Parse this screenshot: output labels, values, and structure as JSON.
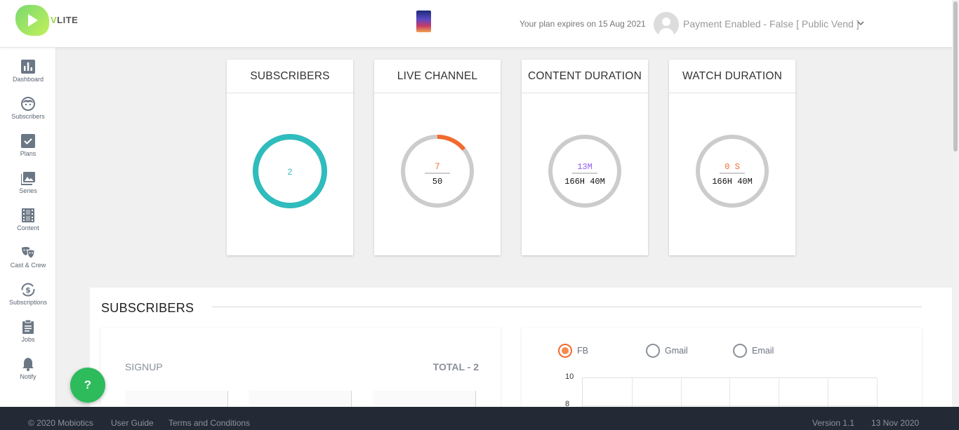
{
  "header": {
    "brand": {
      "v": "V",
      "rest": "LITE"
    },
    "plan_text": "Your plan expires on 15 Aug 2021",
    "user_label": "Payment Enabled - False [ Public Vend ]",
    "caret": "⌄"
  },
  "sidebar": {
    "items": [
      {
        "label": "Dashboard",
        "icon": "bar-chart-icon"
      },
      {
        "label": "Subscribers",
        "icon": "face-icon"
      },
      {
        "label": "Plans",
        "icon": "check-box-icon"
      },
      {
        "label": "Series",
        "icon": "photo-library-icon"
      },
      {
        "label": "Content",
        "icon": "film-strip-icon"
      },
      {
        "label": "Cast & Crew",
        "icon": "theater-masks-icon"
      },
      {
        "label": "Subscriptions",
        "icon": "dollar-cycle-icon"
      },
      {
        "label": "Jobs",
        "icon": "clipboard-icon"
      },
      {
        "label": "Notify",
        "icon": "bell-icon"
      }
    ]
  },
  "cards": [
    {
      "title": "SUBSCRIBERS",
      "top": "2",
      "bottom": "",
      "fraction": 1,
      "ring_color": "#2fbcbc",
      "top_color": "#2fbcbc"
    },
    {
      "title": "LIVE CHANNEL",
      "top": "7",
      "bottom": "50",
      "fraction": 0.14,
      "ring_color": "#f26a2e",
      "top_color": "#f26a2e"
    },
    {
      "title": "CONTENT DURATION",
      "top": "13M",
      "bottom": "166H 40M",
      "fraction": 0.0013,
      "ring_color": "#cccccc",
      "top_color": "#8e5cf0"
    },
    {
      "title": "WATCH DURATION",
      "top": "0 S",
      "bottom": "166H 40M",
      "fraction": 0,
      "ring_color": "#cccccc",
      "top_color": "#f26a2e"
    }
  ],
  "subscribers_section": {
    "title": "SUBSCRIBERS",
    "signup_label": "SIGNUP",
    "total_label": "TOTAL - 2",
    "radios": [
      {
        "label": "FB",
        "selected": true
      },
      {
        "label": "Gmail",
        "selected": false
      },
      {
        "label": "Email",
        "selected": false
      }
    ],
    "y_ticks": [
      "10",
      "8"
    ]
  },
  "help_button": "?",
  "footer": {
    "copyright": "© 2020 Mobiotics",
    "user_guide": "User Guide",
    "terms": "Terms and Conditions",
    "version": "Version 1.1",
    "date": "13 Nov 2020"
  },
  "colors": {
    "accent": "#2dbb5c",
    "teal": "#2fbcbc",
    "orange": "#f26a2e",
    "purple": "#8e5cf0",
    "footer_bg": "#232a35"
  }
}
